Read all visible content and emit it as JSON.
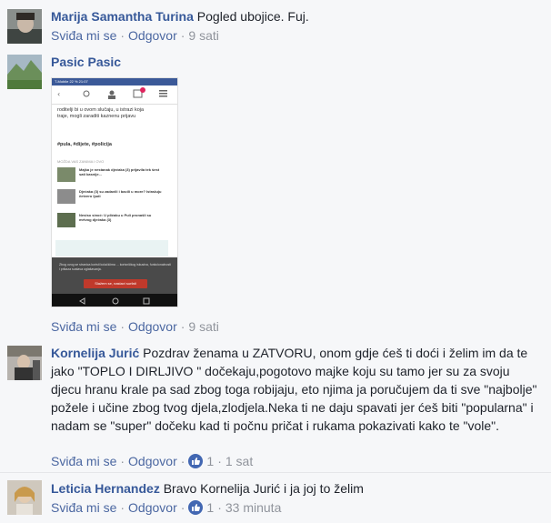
{
  "actions": {
    "like": "Sviđa mi se",
    "reply": "Odgovor",
    "dot": "·"
  },
  "comments": [
    {
      "author": "Marija Samantha Turina",
      "text": "Pogled ubojice. Fuj.",
      "time": "9 sati"
    },
    {
      "author": "Pasic Pasic",
      "text": "",
      "time": "9 sati"
    },
    {
      "author": "Kornelija Jurić",
      "text": "Pozdrav ženama u ZATVORU, onom gdje ćeš ti doći i želim im da te jako \"TOPLO I DIRLJIVO \" dočekaju,pogotovo majke koju su tamo jer su za svoju djecu hranu krale pa sad zbog toga robijaju, eto njima ja poručujem da ti sve \"najbolje\" požele i učine zbog tvog djela,zlodjela.Neka ti ne daju spavati jer ćeš biti \"popularna\" i nadam se \"super\" dočeku kad ti počnu pričat i rukama pokazivati kako te \"vole\".",
      "likes": "1",
      "time": "1 sat"
    },
    {
      "author": "Leticia Hernandez",
      "text": "Bravo Kornelija Jurić i ja joj to želim",
      "likes": "1",
      "time": "33 minuta"
    }
  ],
  "screenshot": {
    "status": "T-Mobile  22 %  21:07",
    "lines": [
      "roditelji bi u ovom slučaju, u istrazi koja",
      "traje, mogli zaraditi kaznenu prijavu"
    ],
    "tags": "#pula, #dijete, #policija",
    "section": "MOŽDA VAS ZANIMA I OVO",
    "items": [
      "Majka je nestanak djećaka (3) prijavila tek šest sati kasnije...",
      "Djećaka (3) su zadavili i bacili u more? Istražuju četvero ljudi",
      "Nesiso sinoć: U plićaku u Puli pronašli su mrtvog dječaka (3)"
    ],
    "cookie": "Zbog ovog se stranica koristi kolačićima ... korisničkog iskustva, funkcionalnosti i prikaza sustava oglašavanja.",
    "button": "Slažem se, nastavi surfati"
  },
  "colors": {
    "author": "#365899",
    "link": "#4b67a1",
    "meta": "#90949c",
    "badge": "#4267b2"
  }
}
